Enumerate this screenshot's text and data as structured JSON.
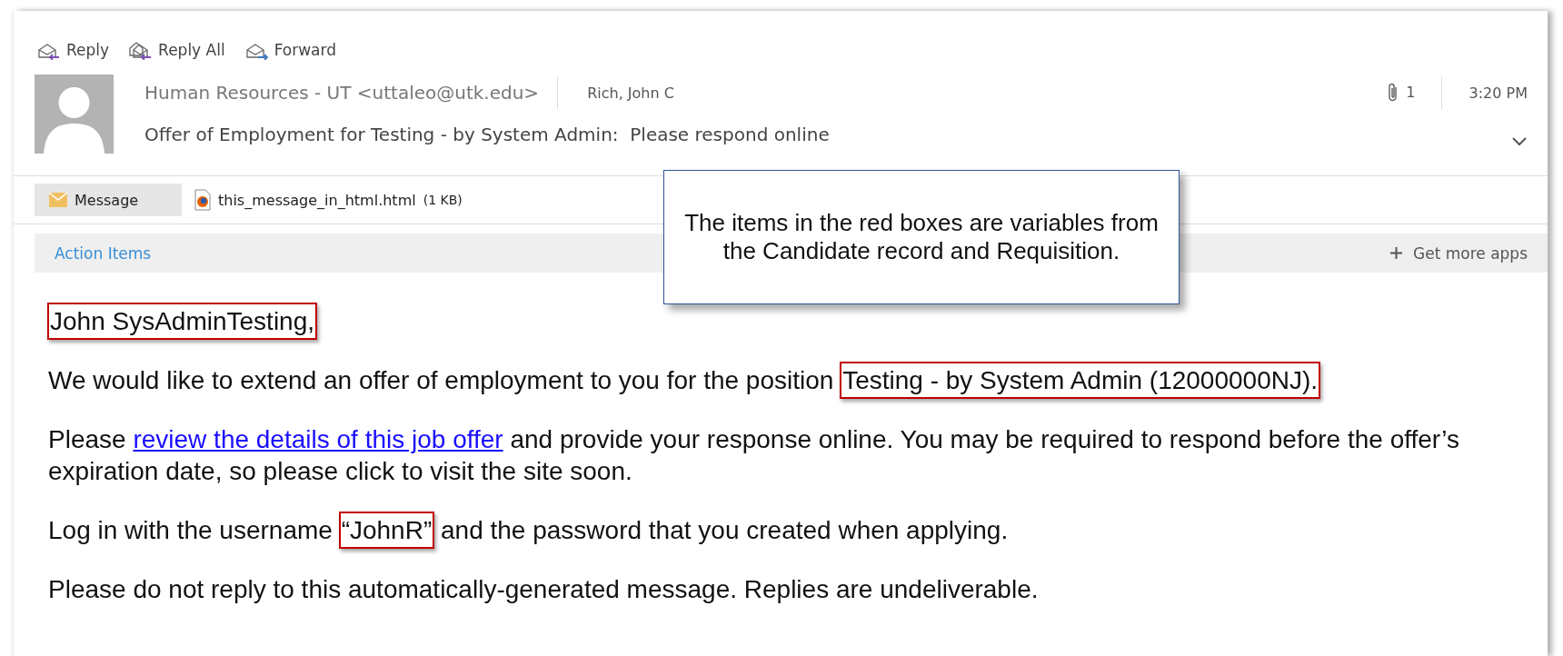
{
  "toolbar": [
    {
      "kind": "reply",
      "label": "Reply"
    },
    {
      "kind": "reply_all",
      "label": "Reply All"
    },
    {
      "kind": "forward",
      "label": "Forward"
    }
  ],
  "header": {
    "sender": "Human Resources - UT <uttaleo@utk.edu>",
    "recipient": "Rich, John C",
    "attachment_count": "1",
    "time": "3:20 PM",
    "subject": "Offer of Employment for Testing - by System Admin:  Please respond online"
  },
  "attachments_bar": [
    {
      "kind": "message",
      "label": "Message",
      "selected": true
    },
    {
      "kind": "file",
      "label": "this_message_in_html.html",
      "size": "(1 KB)",
      "selected": false
    }
  ],
  "action_bar": {
    "label": "Action Items",
    "apps": "Get more apps"
  },
  "callout": {
    "text": "The items in the red boxes are variables from the Candidate record and Requisition."
  },
  "body": [
    {
      "segments": [
        {
          "kind": "variable",
          "text": "John SysAdminTesting,"
        }
      ]
    },
    {
      "segments": [
        {
          "kind": "text",
          "text": "We would like to extend an offer of employment to you for the position "
        },
        {
          "kind": "variable",
          "text": "Testing - by System Admin (12000000NJ)."
        }
      ]
    },
    {
      "segments": [
        {
          "kind": "text",
          "text": "Please "
        },
        {
          "kind": "link",
          "text": "review the details of this job offer"
        },
        {
          "kind": "text",
          "text": " and provide your response online. You may be required to respond before the offer’s expiration date, so please click to visit the site soon."
        }
      ]
    },
    {
      "segments": [
        {
          "kind": "text",
          "text": "Log in with the username "
        },
        {
          "kind": "variable",
          "text": "“JohnR”"
        },
        {
          "kind": "text",
          "text": " and the password that you created when applying."
        }
      ]
    },
    {
      "segments": [
        {
          "kind": "text",
          "text": "Please do not reply to this automatically-generated message. Replies are undeliverable."
        }
      ]
    }
  ]
}
